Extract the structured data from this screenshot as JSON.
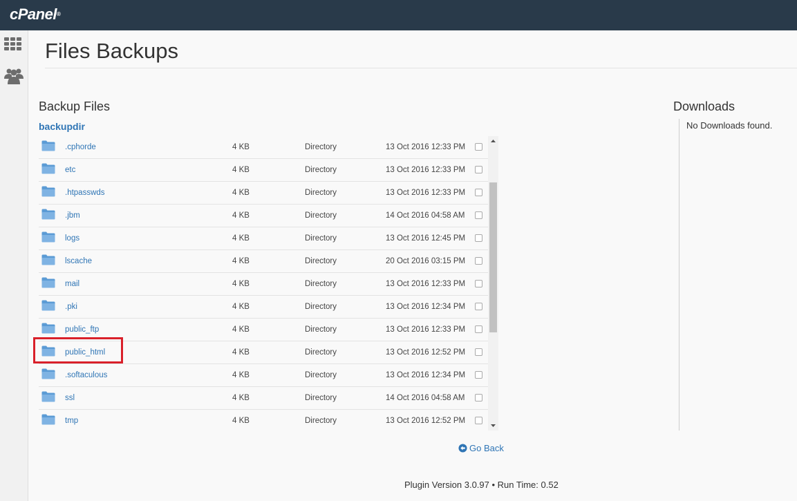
{
  "brand": {
    "logo_text": "cPanel",
    "logo_mark": "®",
    "header_color": "#293a4a"
  },
  "sidebar": {
    "icons": [
      "grid-icon",
      "users-icon"
    ]
  },
  "page": {
    "title": "Files Backups"
  },
  "backup_files": {
    "section_title": "Backup Files",
    "directory": "backupdir",
    "rows": [
      {
        "name": ".cphorde",
        "size": "4 KB",
        "type": "Directory",
        "date": "13 Oct 2016 12:33 PM"
      },
      {
        "name": "etc",
        "size": "4 KB",
        "type": "Directory",
        "date": "13 Oct 2016 12:33 PM"
      },
      {
        "name": ".htpasswds",
        "size": "4 KB",
        "type": "Directory",
        "date": "13 Oct 2016 12:33 PM"
      },
      {
        "name": ".jbm",
        "size": "4 KB",
        "type": "Directory",
        "date": "14 Oct 2016 04:58 AM"
      },
      {
        "name": "logs",
        "size": "4 KB",
        "type": "Directory",
        "date": "13 Oct 2016 12:45 PM"
      },
      {
        "name": "lscache",
        "size": "4 KB",
        "type": "Directory",
        "date": "20 Oct 2016 03:15 PM"
      },
      {
        "name": "mail",
        "size": "4 KB",
        "type": "Directory",
        "date": "13 Oct 2016 12:33 PM"
      },
      {
        "name": ".pki",
        "size": "4 KB",
        "type": "Directory",
        "date": "13 Oct 2016 12:34 PM"
      },
      {
        "name": "public_ftp",
        "size": "4 KB",
        "type": "Directory",
        "date": "13 Oct 2016 12:33 PM"
      },
      {
        "name": "public_html",
        "size": "4 KB",
        "type": "Directory",
        "date": "13 Oct 2016 12:52 PM"
      },
      {
        "name": ".softaculous",
        "size": "4 KB",
        "type": "Directory",
        "date": "13 Oct 2016 12:34 PM"
      },
      {
        "name": "ssl",
        "size": "4 KB",
        "type": "Directory",
        "date": "14 Oct 2016 04:58 AM"
      },
      {
        "name": "tmp",
        "size": "4 KB",
        "type": "Directory",
        "date": "13 Oct 2016 12:52 PM"
      }
    ],
    "highlight_color": "#d9202a"
  },
  "downloads": {
    "title": "Downloads",
    "empty_text": "No Downloads found."
  },
  "go_back": {
    "label": "Go Back"
  },
  "footer": {
    "text": "Plugin Version 3.0.97 • Run Time: 0.52"
  },
  "colors": {
    "link": "#2f75b5",
    "folder": "#5b9bd5"
  }
}
